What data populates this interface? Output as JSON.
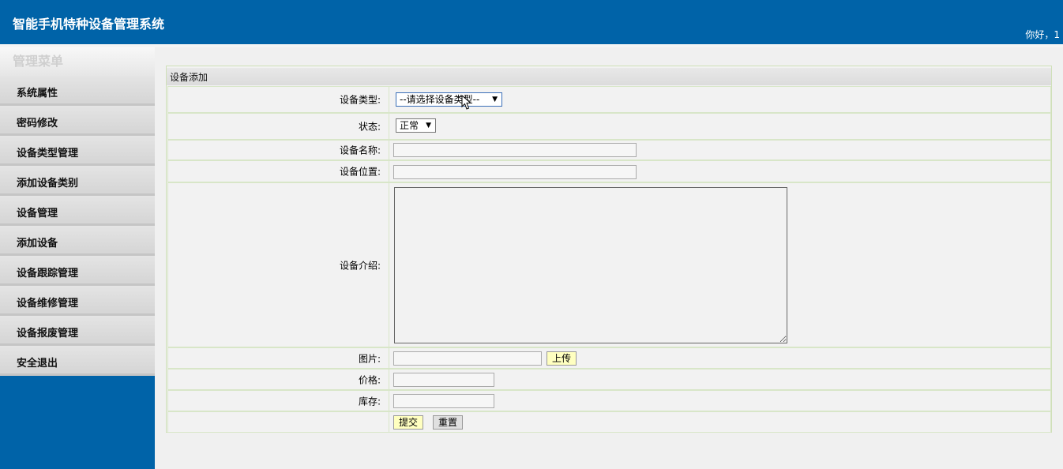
{
  "header": {
    "title": "智能手机特种设备管理系统",
    "greeting": "你好，1"
  },
  "sidebar": {
    "title": "管理菜单",
    "items": [
      {
        "label": "系统属性"
      },
      {
        "label": "密码修改"
      },
      {
        "label": "设备类型管理"
      },
      {
        "label": "添加设备类别"
      },
      {
        "label": "设备管理"
      },
      {
        "label": "添加设备"
      },
      {
        "label": "设备跟踪管理"
      },
      {
        "label": "设备维修管理"
      },
      {
        "label": "设备报废管理"
      },
      {
        "label": "安全退出"
      }
    ]
  },
  "panel": {
    "title": "设备添加"
  },
  "form": {
    "type_label": "设备类型:",
    "type_value": "--请选择设备类型--",
    "status_label": "状态:",
    "status_value": "正常",
    "name_label": "设备名称:",
    "name_value": "",
    "location_label": "设备位置:",
    "location_value": "",
    "intro_label": "设备介绍:",
    "intro_value": "",
    "image_label": "图片:",
    "image_value": "",
    "upload_label": "上传",
    "price_label": "价格:",
    "price_value": "",
    "stock_label": "库存:",
    "stock_value": "",
    "submit_label": "提交",
    "reset_label": "重置"
  },
  "icons": {
    "dropdown_arrow": "chevron-down-icon",
    "cursor": "mouse-pointer-icon"
  },
  "colors": {
    "brand": "#0063a8",
    "button_primary": "#ffffc0",
    "panel_border": "#cfe0b8"
  }
}
